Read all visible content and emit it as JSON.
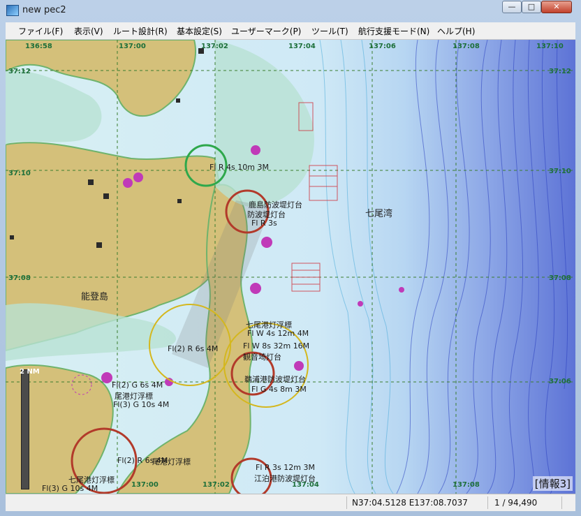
{
  "window": {
    "title": "new pec2",
    "controls": {
      "minimize": "—",
      "maximize": "□",
      "close": "✕"
    }
  },
  "menu": [
    "ファイル(F)",
    "表示(V)",
    "ルート設計(R)",
    "基本設定(S)",
    "ユーザーマーク(P)",
    "ツール(T)",
    "航行支援モード(N)",
    "ヘルプ(H)"
  ],
  "map": {
    "lon_ticks": [
      "136:58",
      "137:00",
      "137:02",
      "137:04",
      "137:06",
      "137:08",
      "137:10"
    ],
    "lon_ticks_bottom": [
      "137:00",
      "137:02",
      "137:04",
      "137:08"
    ],
    "lat_ticks": [
      "37:12",
      "37:10",
      "37:08",
      "37:06"
    ],
    "lat_ticks_left": [
      "37:12",
      "37:10",
      "37:08"
    ],
    "place_names": {
      "bay": "七尾湾",
      "island": "能登島"
    },
    "light_labels": [
      "Fl R 4s 10m 3M",
      "Fl(2) G 6s 4M",
      "尾港灯浮標",
      "Fl(3) G 10s 4M",
      "鵜浦港防波堤灯台",
      "Fl R 3s 12m 3M",
      "江泊港防波堤灯台",
      "七尾港灯浮標",
      "Fl(2) R 6s 4M",
      "尾港灯浮標",
      "Fl(3) G 10s 4M",
      "七尾港灯浮標",
      "Fl W 8s 32m 16M",
      "観音埼灯台",
      "Fl G 4s 8m 3M",
      "Fl W 4s 12m 4M",
      "鹿島防波堤灯台",
      "Fl R 3s",
      "防波堤灯台",
      "Fl(2) R 6s 4M"
    ],
    "scale_label": "2 NM",
    "info_box": "[情報3]",
    "colors": {
      "land": "#d4c07a",
      "shallow": "#b8e1d3",
      "contour_green": "#66c96a",
      "deep": "#2a3fbf",
      "grid": "#3a7d2e",
      "mark_magenta": "#c03ab8",
      "circle_red": "#b23a2a",
      "circle_green": "#2ea84b",
      "circle_yellow": "#d4b71e"
    }
  },
  "status": {
    "coords": "N37:04.5128 E137:08.7037",
    "scale": "1 / 94,490"
  }
}
